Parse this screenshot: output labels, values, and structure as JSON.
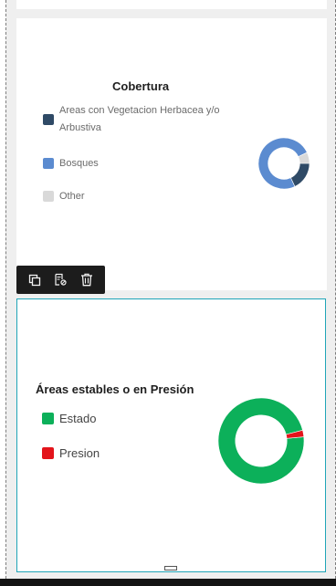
{
  "colors": {
    "herbacea": "#2f4a66",
    "bosques": "#5b8bd0",
    "other": "#d9d9d9",
    "estado": "#0cb05a",
    "presion": "#e3141b",
    "selection_border": "#1fa5b8"
  },
  "widget_toolbar": {
    "duplicate_icon": "copy-icon",
    "edit_icon": "edit-settings-icon",
    "delete_icon": "trash-icon"
  },
  "chart_data": [
    {
      "type": "pie",
      "title": "Cobertura",
      "labels": [
        "Areas con Vegetacion Herbacea y/o Arbustiva",
        "Bosques",
        "Other"
      ],
      "values": [
        0.18,
        0.75,
        0.07
      ],
      "legend": "left"
    },
    {
      "type": "pie",
      "title": "Áreas estables o en Presión",
      "labels": [
        "Estado",
        "Presion"
      ],
      "values": [
        0.975,
        0.025
      ],
      "legend": "left"
    }
  ]
}
